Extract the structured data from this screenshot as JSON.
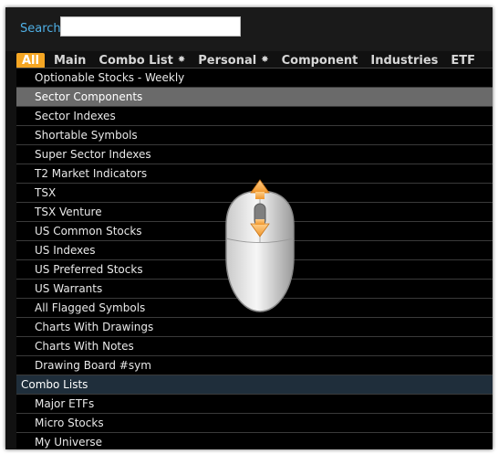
{
  "search": {
    "label": "Search",
    "value": "",
    "placeholder": ""
  },
  "tabs": [
    {
      "label": "All",
      "active": true
    },
    {
      "label": "Main"
    },
    {
      "label": "Combo List",
      "star": "✸"
    },
    {
      "label": "Personal",
      "star": "✸"
    },
    {
      "label": "Component"
    },
    {
      "label": "Industries"
    },
    {
      "label": "ETF"
    }
  ],
  "list": {
    "items": [
      "Optionable Stocks - Weekly",
      "Sector Components",
      "Sector Indexes",
      "Shortable Symbols",
      "Super Sector Indexes",
      "T2 Market Indicators",
      "TSX",
      "TSX Venture",
      "US Common Stocks",
      "US Indexes",
      "US Preferred Stocks",
      "US Warrants",
      "All Flagged Symbols",
      "Charts With Drawings",
      "Charts With Notes",
      "Drawing Board #sym"
    ],
    "section_header": "Combo Lists",
    "combo_items": [
      "Major ETFs",
      "Micro Stocks",
      "My Universe"
    ]
  },
  "colors": {
    "accent": "#f5a623",
    "search_label": "#4fb0e6",
    "selected_row": "#6a6a6a",
    "section_header": "#1f2e3b"
  },
  "overlay": {
    "icon": "scroll-mouse-icon"
  }
}
